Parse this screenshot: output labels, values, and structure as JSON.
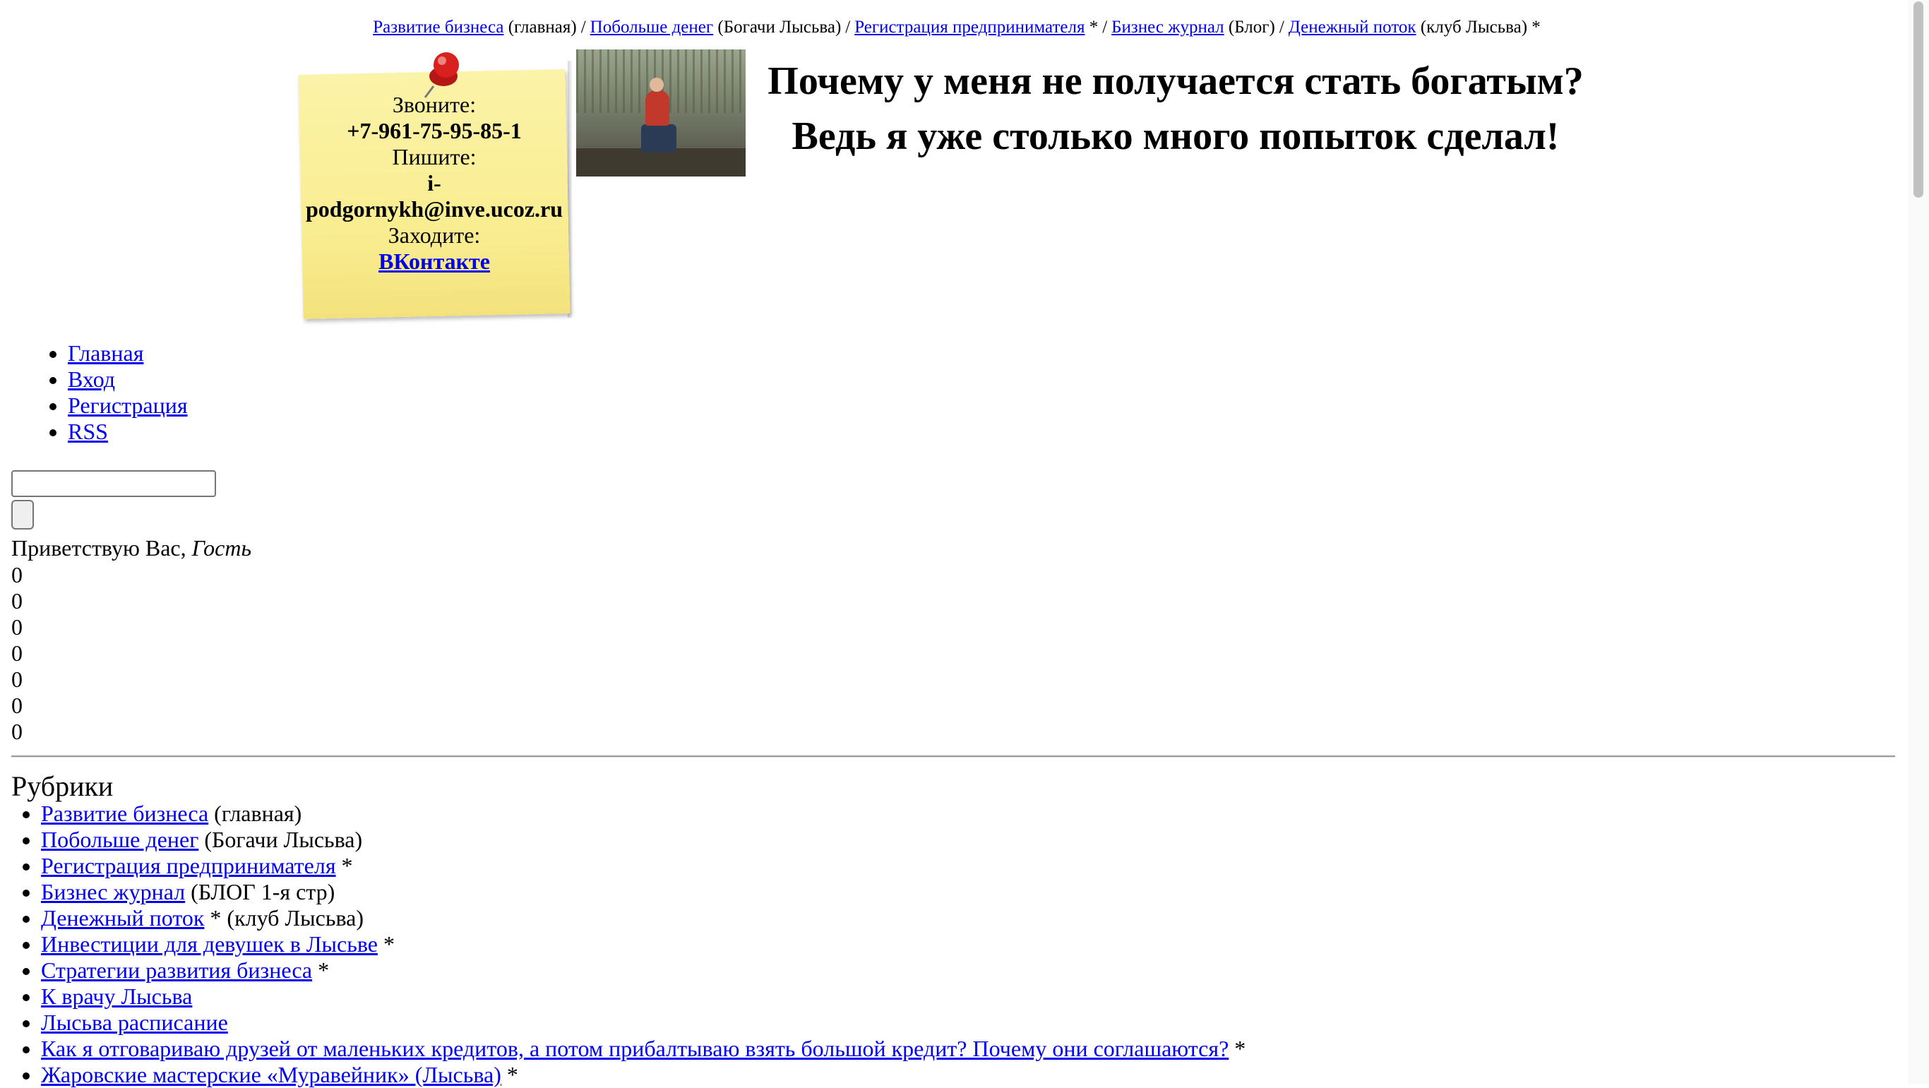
{
  "top_nav": [
    {
      "link": "Развитие бизнеса",
      "note": " (главная)",
      "sep": "/"
    },
    {
      "link": "Побольше денег",
      "note": " (Богачи Лысьва)",
      "sep": "/"
    },
    {
      "link": "Регистрация предпринимателя",
      "note": " *",
      "sep": "/"
    },
    {
      "link": "Бизнес журнал",
      "note": " (Блог)",
      "sep": "/"
    },
    {
      "link": "Денежный поток",
      "note": " (клуб Лысьва) *",
      "sep": ""
    }
  ],
  "contact_note": {
    "call_label": "Звоните:",
    "phone": "+7-961-75-95-85-1",
    "write_label": "Пишите:",
    "email_line1": "i-",
    "email_line2": "podgornykh@inve.ucoz.ru",
    "visit_label": "Заходите:",
    "vk_link": "ВКонтакте",
    "pin_color": "#d8201f",
    "note_color": "#f9ec8f"
  },
  "header": {
    "slogan_line1": "Почему у меня не получается стать богатым?",
    "slogan_line2": "Ведь я уже столько много попыток сделал!"
  },
  "user_menu": [
    "Главная",
    "Вход",
    "Регистрация",
    "RSS"
  ],
  "search": {
    "value": "",
    "button_label": ""
  },
  "greeting": {
    "text": "Приветствую Вас, ",
    "user": "Гость"
  },
  "counters": [
    "0",
    "0",
    "0",
    "0",
    "0",
    "0",
    "0"
  ],
  "rubrics": {
    "title": "Рубрики",
    "items": [
      {
        "link": "Развитие бизнеса",
        "note": " (главная)"
      },
      {
        "link": "Побольше денег",
        "note": " (Богачи Лысьва)"
      },
      {
        "link": "Регистрация предпринимателя",
        "note": " *"
      },
      {
        "link": "Бизнес журнал",
        "note": " (БЛОГ 1-я стр)"
      },
      {
        "link": "Денежный поток",
        "note": " * (клуб Лысьва)"
      },
      {
        "link": "Инвестиции для девушек в Лысьве",
        "note": " *"
      },
      {
        "link": "Стратегии развития бизнеса",
        "note": " *"
      },
      {
        "link": "К врачу Лысьва",
        "note": ""
      },
      {
        "link": "Лысьва расписание",
        "note": ""
      },
      {
        "link": "Как я отговариваю друзей от маленьких кредитов, а потом прибалтываю взять большой кредит? Почему они соглашаются?",
        "note": " *"
      },
      {
        "link": "Жаровские мастерские «Муравейник» (Лысьва)",
        "note": " *"
      }
    ]
  },
  "colors": {
    "link": "#0000ee",
    "text": "#000000",
    "background": "#ffffff"
  }
}
